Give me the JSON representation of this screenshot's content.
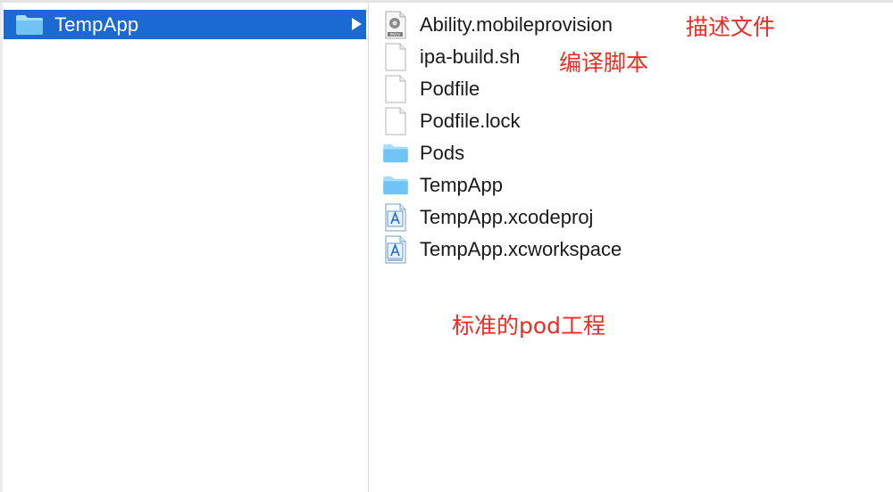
{
  "left_column": {
    "selected_item": {
      "label": "TempApp",
      "icon": "folder-icon"
    },
    "expand_icon": "chevron-right-icon"
  },
  "right_column": {
    "files": [
      {
        "name": "Ability.mobileprovision",
        "icon": "provisioning-profile-icon"
      },
      {
        "name": "ipa-build.sh",
        "icon": "document-icon"
      },
      {
        "name": "Podfile",
        "icon": "document-icon"
      },
      {
        "name": "Podfile.lock",
        "icon": "document-icon"
      },
      {
        "name": "Pods",
        "icon": "folder-icon"
      },
      {
        "name": "TempApp",
        "icon": "folder-icon"
      },
      {
        "name": "TempApp.xcodeproj",
        "icon": "xcode-project-icon"
      },
      {
        "name": "TempApp.xcworkspace",
        "icon": "xcode-workspace-icon"
      }
    ]
  },
  "annotations": {
    "profile_note": "描述文件",
    "script_note": "编译脚本",
    "project_note": "标准的pod工程"
  },
  "colors": {
    "selection": "#1b6ad4",
    "annotation": "#ee2b24",
    "folder": "#6fc3f5"
  }
}
